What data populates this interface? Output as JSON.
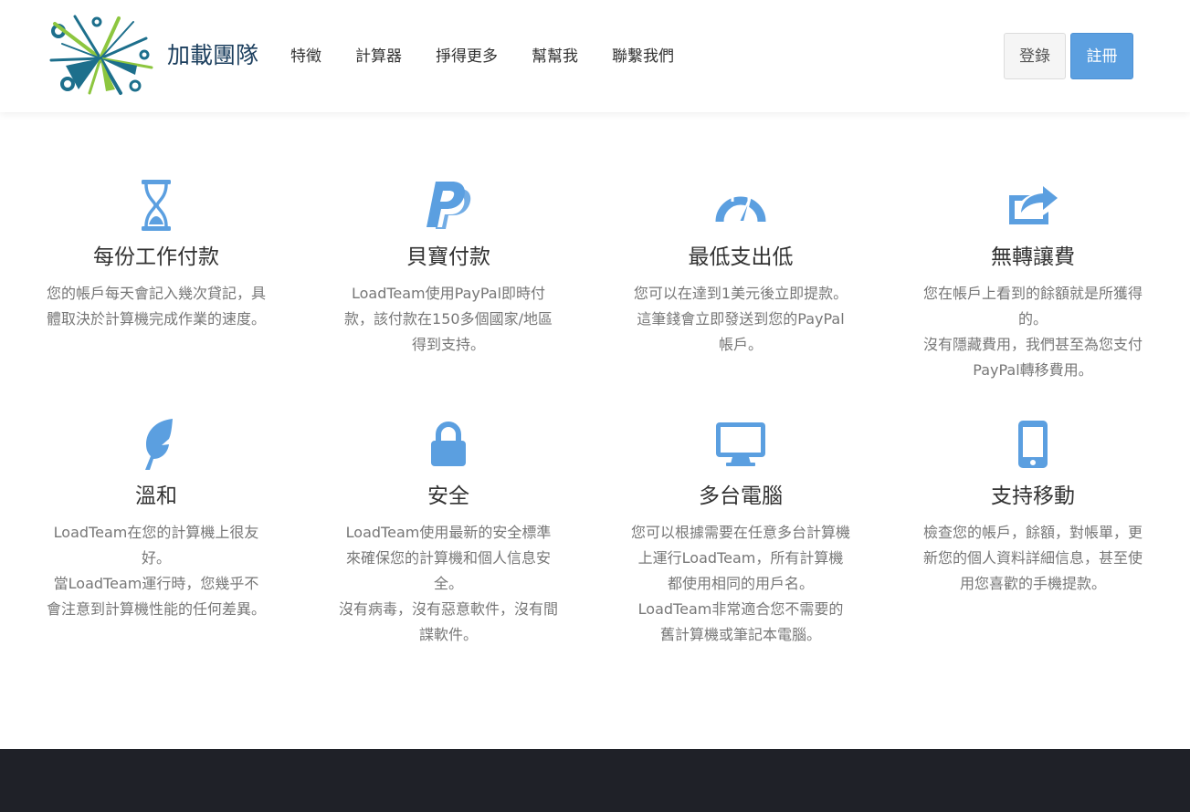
{
  "brand": {
    "name": "加載團隊"
  },
  "nav": {
    "items": [
      "特徵",
      "計算器",
      "掙得更多",
      "幫幫我",
      "聯繫我們"
    ],
    "login": "登錄",
    "register": "註冊"
  },
  "colors": {
    "accent": "#5b9fe0",
    "footer": "#1f2128",
    "brand_text": "#1c3f5e"
  },
  "features": [
    {
      "icon": "hourglass-icon",
      "title": "每份工作付款",
      "desc": "您的帳戶每天會記入幾次貸記，具體取決於計算機完成作業的速度。"
    },
    {
      "icon": "paypal-icon",
      "title": "貝寶付款",
      "desc": "LoadTeam使用PayPal即時付款，該付款在150多個國家/地區得到支持。"
    },
    {
      "icon": "gauge-icon",
      "title": "最低支出低",
      "desc": "您可以在達到1美元後立即提款。\n這筆錢會立即發送到您的PayPal帳戶。"
    },
    {
      "icon": "share-icon",
      "title": "無轉讓費",
      "desc": "您在帳戶上看到的餘額就是所獲得的。\n沒有隱藏費用，我們甚至為您支付PayPal轉移費用。"
    },
    {
      "icon": "feather-icon",
      "title": "溫和",
      "desc": "LoadTeam在您的計算機上很友好。\n當LoadTeam運行時，您幾乎不會注意到計算機性能的任何差異。"
    },
    {
      "icon": "lock-icon",
      "title": "安全",
      "desc": "LoadTeam使用最新的安全標準來確保您的計算機和個人信息安全。\n沒有病毒，沒有惡意軟件，沒有間諜軟件。"
    },
    {
      "icon": "monitor-icon",
      "title": "多台電腦",
      "desc": "您可以根據需要在任意多台計算機上運行LoadTeam，所有計算機都使用相同的用戶名。\nLoadTeam非常適合您不需要的舊計算機或筆記本電腦。"
    },
    {
      "icon": "mobile-icon",
      "title": "支持移動",
      "desc": "檢查您的帳戶，餘額，對帳單，更新您的個人資料詳細信息，甚至使用您喜歡的手機提款。"
    }
  ]
}
